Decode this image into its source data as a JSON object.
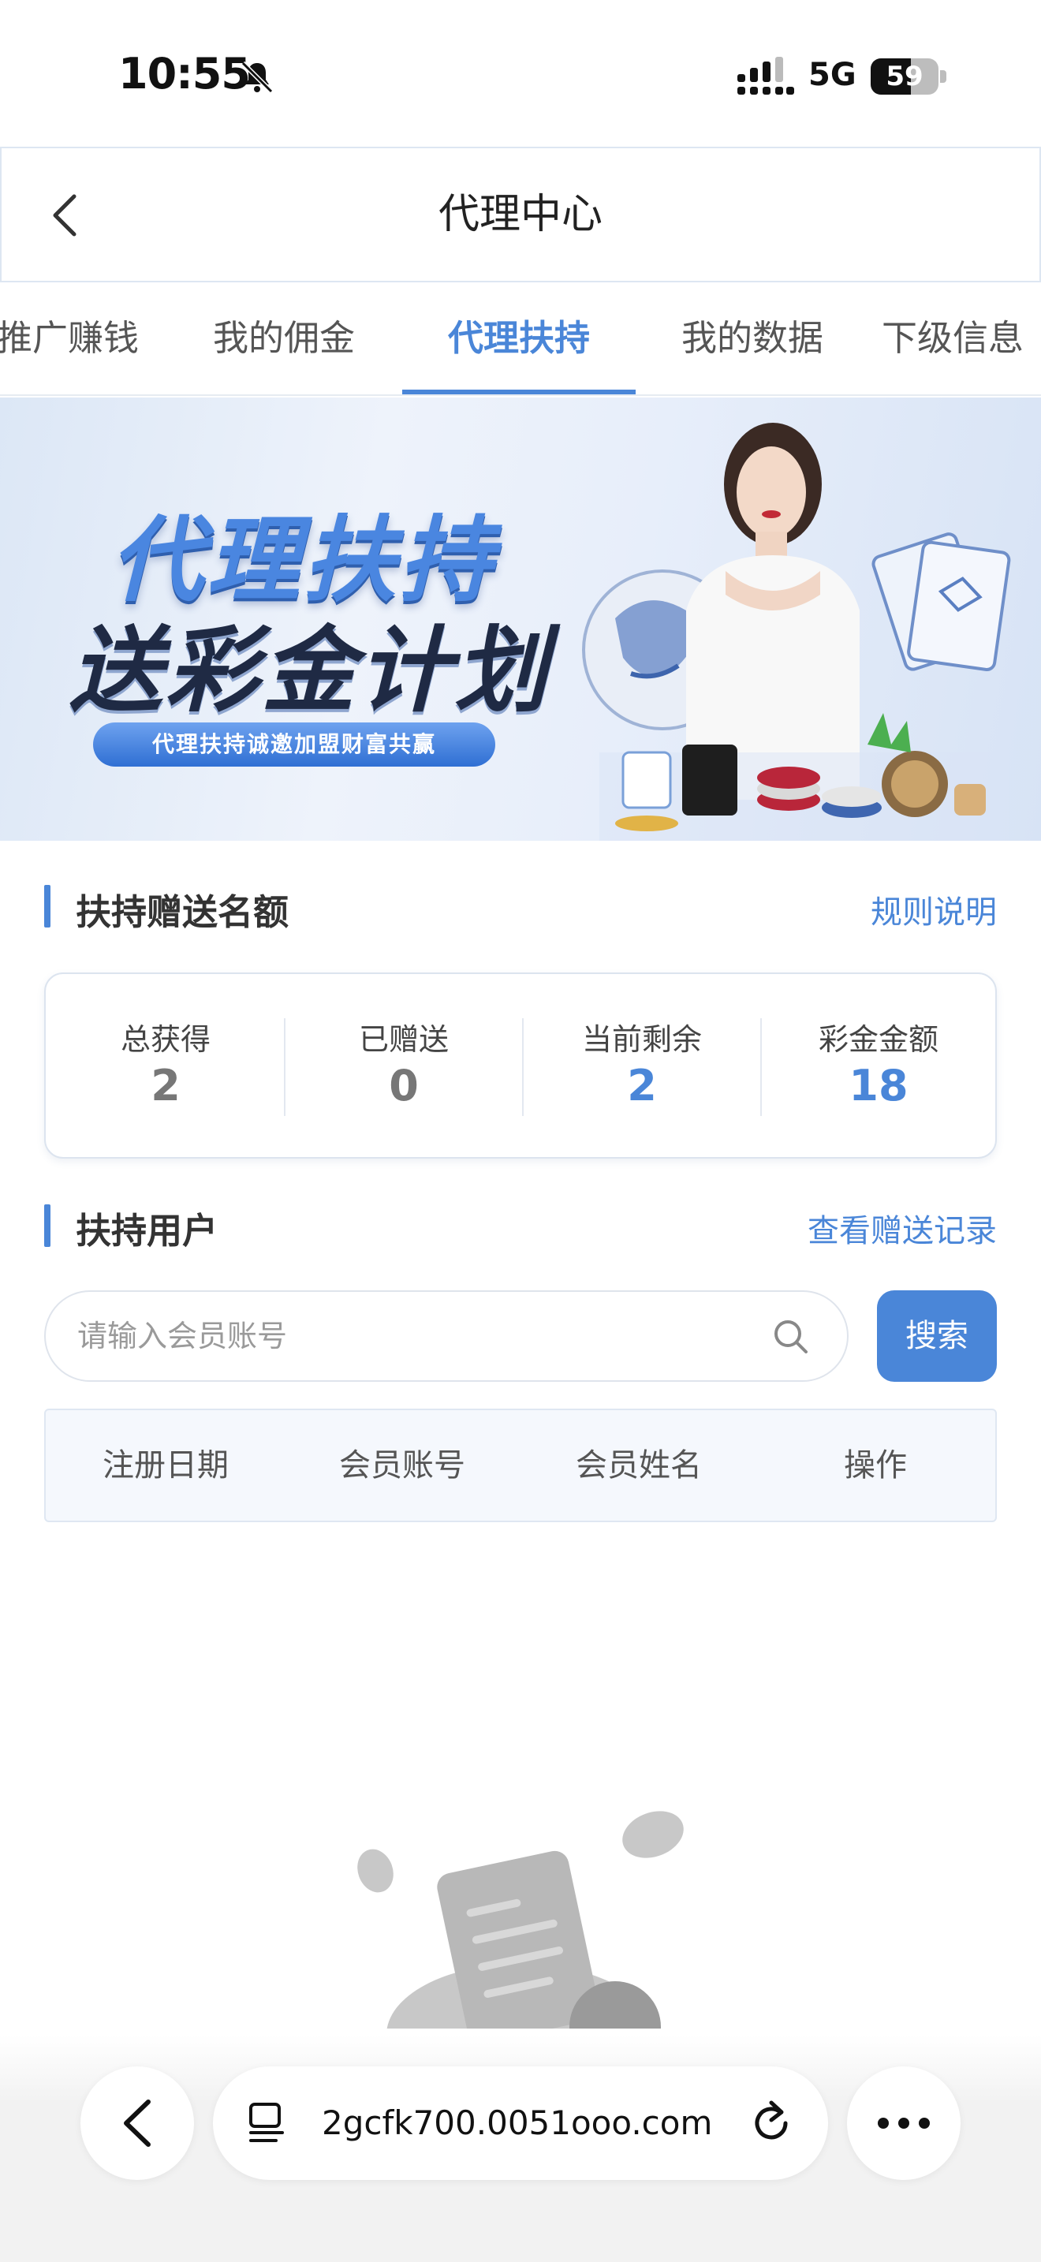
{
  "status_bar": {
    "time": "10:55",
    "network": "5G",
    "battery_level": "59",
    "battery_fraction": 0.59
  },
  "header": {
    "title": "代理中心"
  },
  "tabs": [
    {
      "label": "推广赚钱"
    },
    {
      "label": "我的佣金"
    },
    {
      "label": "代理扶持"
    },
    {
      "label": "我的数据"
    },
    {
      "label": "下级信息"
    }
  ],
  "active_tab": "代理扶持",
  "banner": {
    "title_line1": "代理扶持",
    "title_line2": "送彩金计划",
    "tagline": "代理扶持诚邀加盟财富共赢"
  },
  "quota_section": {
    "title": "扶持赠送名额",
    "link": "规则说明"
  },
  "stats": [
    {
      "label": "总获得",
      "value": "2"
    },
    {
      "label": "已赠送",
      "value": "0"
    },
    {
      "label": "当前剩余",
      "value": "2"
    },
    {
      "label": "彩金金额",
      "value": "18"
    }
  ],
  "users_section": {
    "title": "扶持用户",
    "link": "查看赠送记录"
  },
  "search": {
    "placeholder": "请输入会员账号",
    "value": "",
    "button": "搜索"
  },
  "table": {
    "columns": [
      "注册日期",
      "会员账号",
      "会员姓名",
      "操作"
    ],
    "rows": []
  },
  "browser": {
    "url": "2gcfk700.0051ooo.com"
  },
  "colors": {
    "accent": "#4a86d8",
    "stat_muted": "#777777",
    "divider": "#e3e8f0"
  }
}
